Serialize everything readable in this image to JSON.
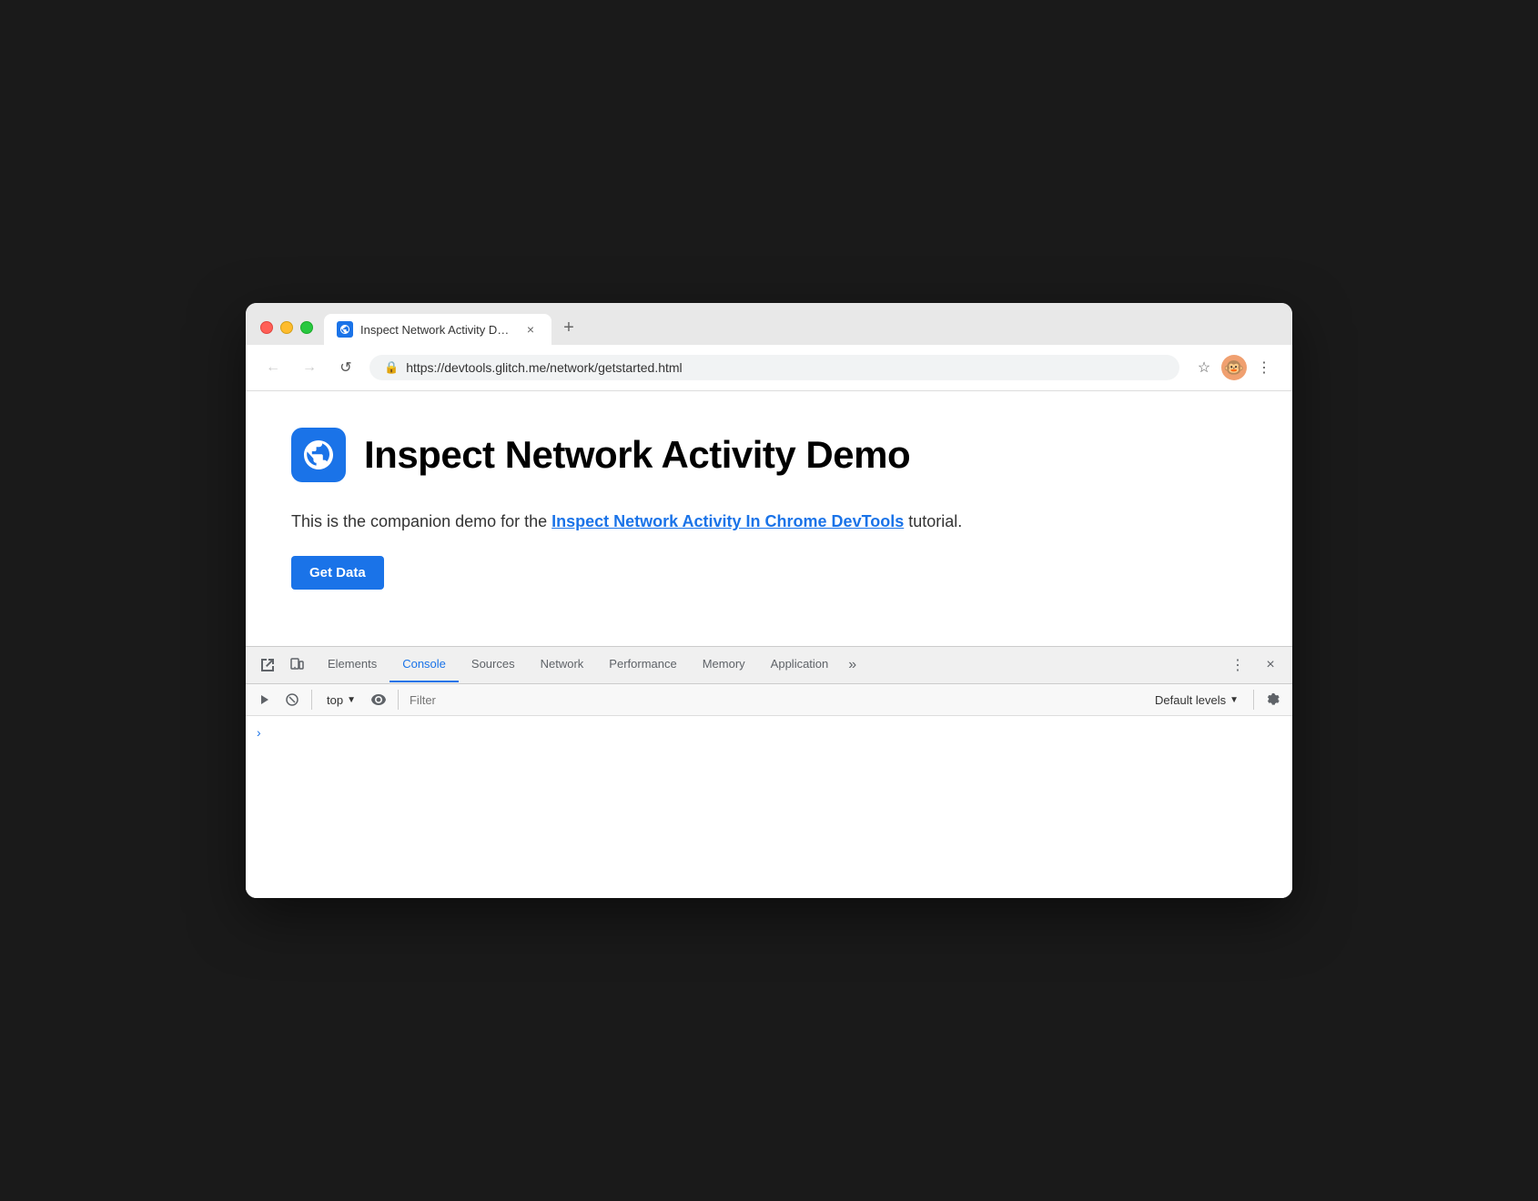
{
  "browser": {
    "traffic_lights": [
      "red",
      "yellow",
      "green"
    ],
    "tab": {
      "title": "Inspect Network Activity Demo",
      "close_label": "×"
    },
    "new_tab_label": "+",
    "nav": {
      "back_label": "←",
      "forward_label": "→",
      "reload_label": "↺"
    },
    "url": {
      "protocol": "https://devtools.glitch.me",
      "path": "/network/getstarted.html",
      "full": "https://devtools.glitch.me/network/getstarted.html"
    },
    "toolbar": {
      "star_label": "☆",
      "menu_label": "⋮"
    }
  },
  "page": {
    "title": "Inspect Network Activity Demo",
    "description_prefix": "This is the companion demo for the ",
    "link_text": "Inspect Network Activity In Chrome DevTools",
    "description_suffix": " tutorial.",
    "button_label": "Get Data"
  },
  "devtools": {
    "tabs": [
      {
        "label": "Elements",
        "active": false
      },
      {
        "label": "Console",
        "active": true
      },
      {
        "label": "Sources",
        "active": false
      },
      {
        "label": "Network",
        "active": false
      },
      {
        "label": "Performance",
        "active": false
      },
      {
        "label": "Memory",
        "active": false
      },
      {
        "label": "Application",
        "active": false
      }
    ],
    "more_label": "»",
    "close_label": "×",
    "menu_label": "⋮",
    "console": {
      "context": "top",
      "filter_placeholder": "Filter",
      "default_levels_label": "Default levels",
      "chevron_label": "›"
    }
  }
}
